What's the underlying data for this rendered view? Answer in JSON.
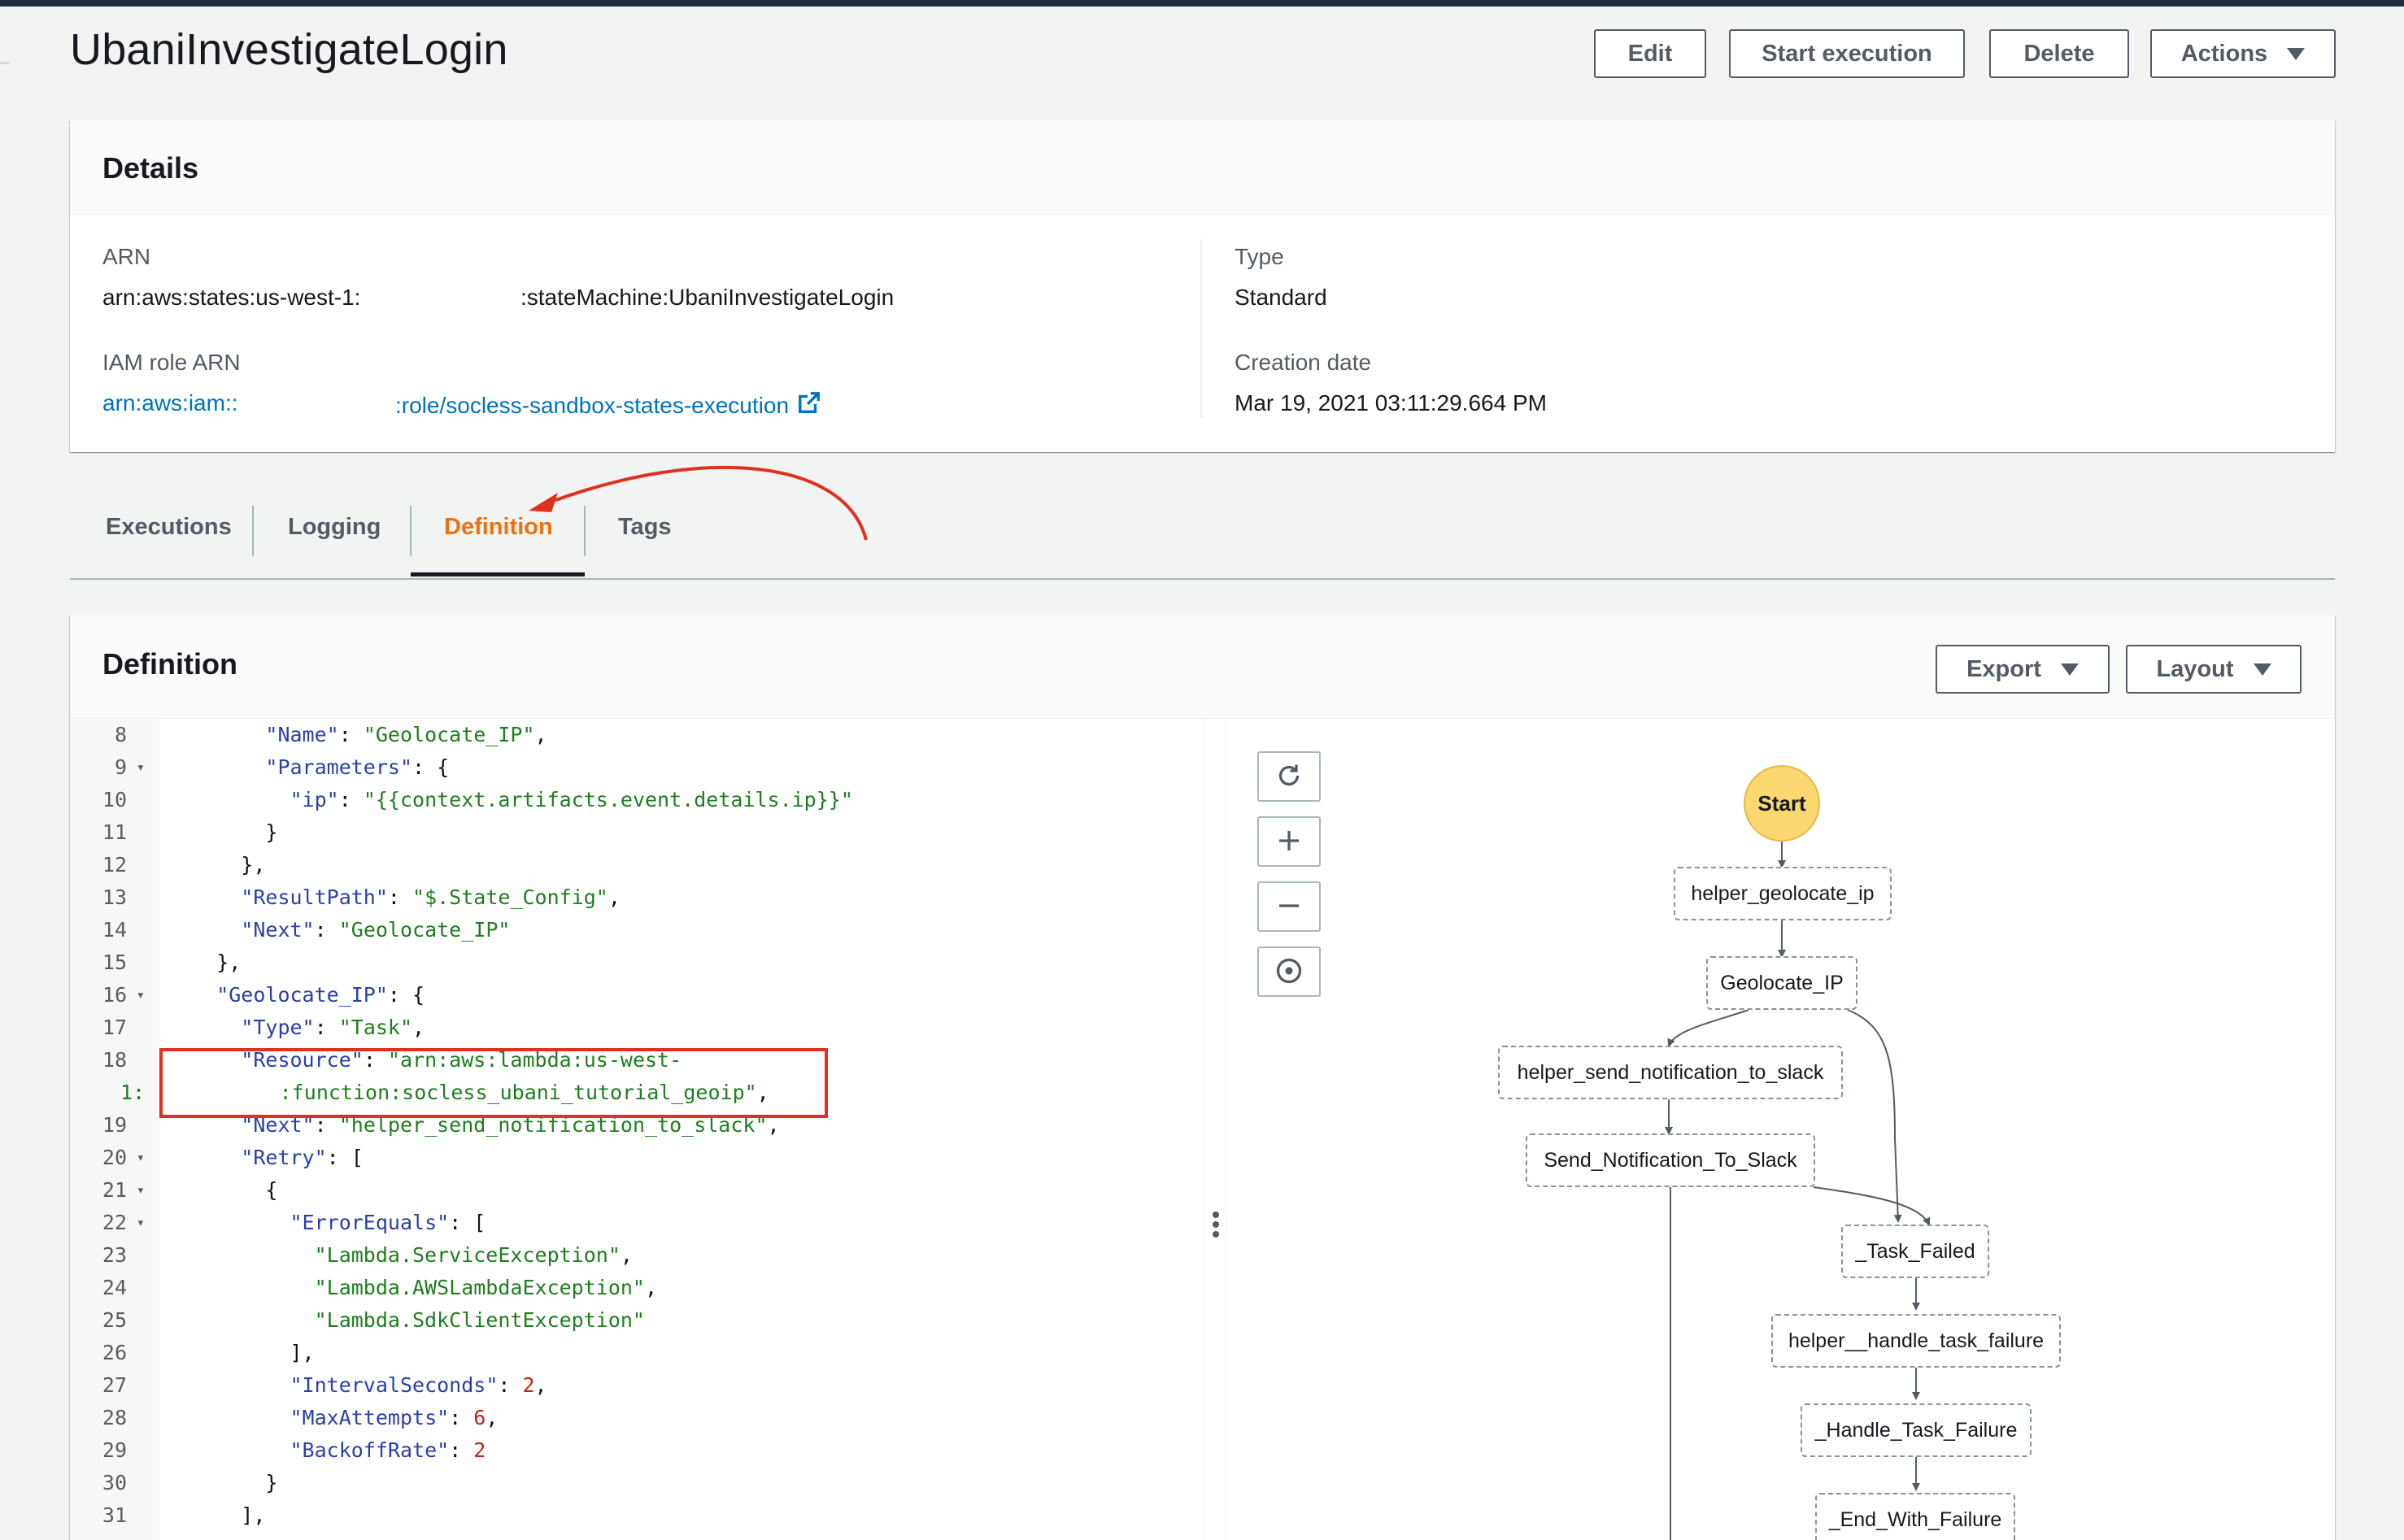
{
  "page": {
    "title": "UbaniInvestigateLogin"
  },
  "header_actions": {
    "edit": "Edit",
    "start_execution": "Start execution",
    "delete": "Delete",
    "actions": "Actions"
  },
  "details": {
    "title": "Details",
    "arn_label": "ARN",
    "arn_prefix": "arn:aws:states:us-west-1:",
    "arn_suffix": ":stateMachine:UbaniInvestigateLogin",
    "iam_label": "IAM role ARN",
    "iam_prefix": "arn:aws:iam::",
    "iam_suffix": ":role/socless-sandbox-states-execution",
    "type_label": "Type",
    "type_value": "Standard",
    "creation_label": "Creation date",
    "creation_value": "Mar 19, 2021 03:11:29.664 PM"
  },
  "tabs": [
    {
      "label": "Executions"
    },
    {
      "label": "Logging"
    },
    {
      "label": "Definition"
    },
    {
      "label": "Tags"
    }
  ],
  "definition": {
    "title": "Definition",
    "export": "Export",
    "layout": "Layout"
  },
  "code": {
    "lines": [
      {
        "n": "8",
        "fold": false,
        "indent": 8,
        "tokens": [
          {
            "t": "k",
            "v": "\"Name\""
          },
          {
            "t": "p",
            "v": ": "
          },
          {
            "t": "s",
            "v": "\"Geolocate_IP\""
          },
          {
            "t": "p",
            "v": ","
          }
        ]
      },
      {
        "n": "9",
        "fold": true,
        "indent": 8,
        "tokens": [
          {
            "t": "k",
            "v": "\"Parameters\""
          },
          {
            "t": "p",
            "v": ": {"
          }
        ]
      },
      {
        "n": "10",
        "fold": false,
        "indent": 10,
        "tokens": [
          {
            "t": "k",
            "v": "\"ip\""
          },
          {
            "t": "p",
            "v": ": "
          },
          {
            "t": "s",
            "v": "\"{{context.artifacts.event.details.ip}}\""
          }
        ]
      },
      {
        "n": "11",
        "fold": false,
        "indent": 8,
        "tokens": [
          {
            "t": "p",
            "v": "}"
          }
        ]
      },
      {
        "n": "12",
        "fold": false,
        "indent": 6,
        "tokens": [
          {
            "t": "p",
            "v": "},"
          }
        ]
      },
      {
        "n": "13",
        "fold": false,
        "indent": 6,
        "tokens": [
          {
            "t": "k",
            "v": "\"ResultPath\""
          },
          {
            "t": "p",
            "v": ": "
          },
          {
            "t": "s",
            "v": "\"$.State_Config\""
          },
          {
            "t": "p",
            "v": ","
          }
        ]
      },
      {
        "n": "14",
        "fold": false,
        "indent": 6,
        "tokens": [
          {
            "t": "k",
            "v": "\"Next\""
          },
          {
            "t": "p",
            "v": ": "
          },
          {
            "t": "s",
            "v": "\"Geolocate_IP\""
          }
        ]
      },
      {
        "n": "15",
        "fold": false,
        "indent": 4,
        "tokens": [
          {
            "t": "p",
            "v": "},"
          }
        ]
      },
      {
        "n": "16",
        "fold": true,
        "indent": 4,
        "tokens": [
          {
            "t": "k",
            "v": "\"Geolocate_IP\""
          },
          {
            "t": "p",
            "v": ": {"
          }
        ]
      },
      {
        "n": "17",
        "fold": false,
        "indent": 6,
        "tokens": [
          {
            "t": "k",
            "v": "\"Type\""
          },
          {
            "t": "p",
            "v": ": "
          },
          {
            "t": "s",
            "v": "\"Task\""
          },
          {
            "t": "p",
            "v": ","
          }
        ]
      },
      {
        "n": "18",
        "fold": false,
        "indent": 6,
        "tokens": [
          {
            "t": "k",
            "v": "\"Resource\""
          },
          {
            "t": "p",
            "v": ": "
          },
          {
            "t": "s",
            "v": "\"arn:aws:lambda:us-west-"
          }
        ]
      },
      {
        "n": "",
        "fold": false,
        "indent": 0,
        "tokens": [
          {
            "t": "s",
            "v": "1:           :function:socless_ubani_tutorial_geoip\""
          },
          {
            "t": "p",
            "v": ","
          }
        ]
      },
      {
        "n": "19",
        "fold": false,
        "indent": 6,
        "tokens": [
          {
            "t": "k",
            "v": "\"Next\""
          },
          {
            "t": "p",
            "v": ": "
          },
          {
            "t": "s",
            "v": "\"helper_send_notification_to_slack\""
          },
          {
            "t": "p",
            "v": ","
          }
        ]
      },
      {
        "n": "20",
        "fold": true,
        "indent": 6,
        "tokens": [
          {
            "t": "k",
            "v": "\"Retry\""
          },
          {
            "t": "p",
            "v": ": ["
          }
        ]
      },
      {
        "n": "21",
        "fold": true,
        "indent": 8,
        "tokens": [
          {
            "t": "p",
            "v": "{"
          }
        ]
      },
      {
        "n": "22",
        "fold": true,
        "indent": 10,
        "tokens": [
          {
            "t": "k",
            "v": "\"ErrorEquals\""
          },
          {
            "t": "p",
            "v": ": ["
          }
        ]
      },
      {
        "n": "23",
        "fold": false,
        "indent": 12,
        "tokens": [
          {
            "t": "s",
            "v": "\"Lambda.ServiceException\""
          },
          {
            "t": "p",
            "v": ","
          }
        ]
      },
      {
        "n": "24",
        "fold": false,
        "indent": 12,
        "tokens": [
          {
            "t": "s",
            "v": "\"Lambda.AWSLambdaException\""
          },
          {
            "t": "p",
            "v": ","
          }
        ]
      },
      {
        "n": "25",
        "fold": false,
        "indent": 12,
        "tokens": [
          {
            "t": "s",
            "v": "\"Lambda.SdkClientException\""
          }
        ]
      },
      {
        "n": "26",
        "fold": false,
        "indent": 10,
        "tokens": [
          {
            "t": "p",
            "v": "],"
          }
        ]
      },
      {
        "n": "27",
        "fold": false,
        "indent": 10,
        "tokens": [
          {
            "t": "k",
            "v": "\"IntervalSeconds\""
          },
          {
            "t": "p",
            "v": ": "
          },
          {
            "t": "n",
            "v": "2"
          },
          {
            "t": "p",
            "v": ","
          }
        ]
      },
      {
        "n": "28",
        "fold": false,
        "indent": 10,
        "tokens": [
          {
            "t": "k",
            "v": "\"MaxAttempts\""
          },
          {
            "t": "p",
            "v": ": "
          },
          {
            "t": "n",
            "v": "6"
          },
          {
            "t": "p",
            "v": ","
          }
        ]
      },
      {
        "n": "29",
        "fold": false,
        "indent": 10,
        "tokens": [
          {
            "t": "k",
            "v": "\"BackoffRate\""
          },
          {
            "t": "p",
            "v": ": "
          },
          {
            "t": "n",
            "v": "2"
          }
        ]
      },
      {
        "n": "30",
        "fold": false,
        "indent": 8,
        "tokens": [
          {
            "t": "p",
            "v": "}"
          }
        ]
      },
      {
        "n": "31",
        "fold": false,
        "indent": 6,
        "tokens": [
          {
            "t": "p",
            "v": "],"
          }
        ]
      }
    ]
  },
  "graph": {
    "start": "Start",
    "nodes": {
      "helper_geolocate_ip": "helper_geolocate_ip",
      "geolocate_ip": "Geolocate_IP",
      "helper_send_notification": "helper_send_notification_to_slack",
      "send_notification": "Send_Notification_To_Slack",
      "task_failed": "_Task_Failed",
      "helper_handle_failure": "helper__handle_task_failure",
      "handle_failure": "_Handle_Task_Failure",
      "end_with_failure": "_End_With_Failure"
    }
  },
  "icons": {
    "external_link": "external-link-icon",
    "refresh": "refresh-icon",
    "zoom_in": "zoom-in-icon",
    "zoom_out": "zoom-out-icon",
    "center": "center-icon"
  },
  "colors": {
    "accent": "#ec7211",
    "link": "#0073bb",
    "annotation": "#e0301e",
    "start_node": "#fcd771"
  }
}
